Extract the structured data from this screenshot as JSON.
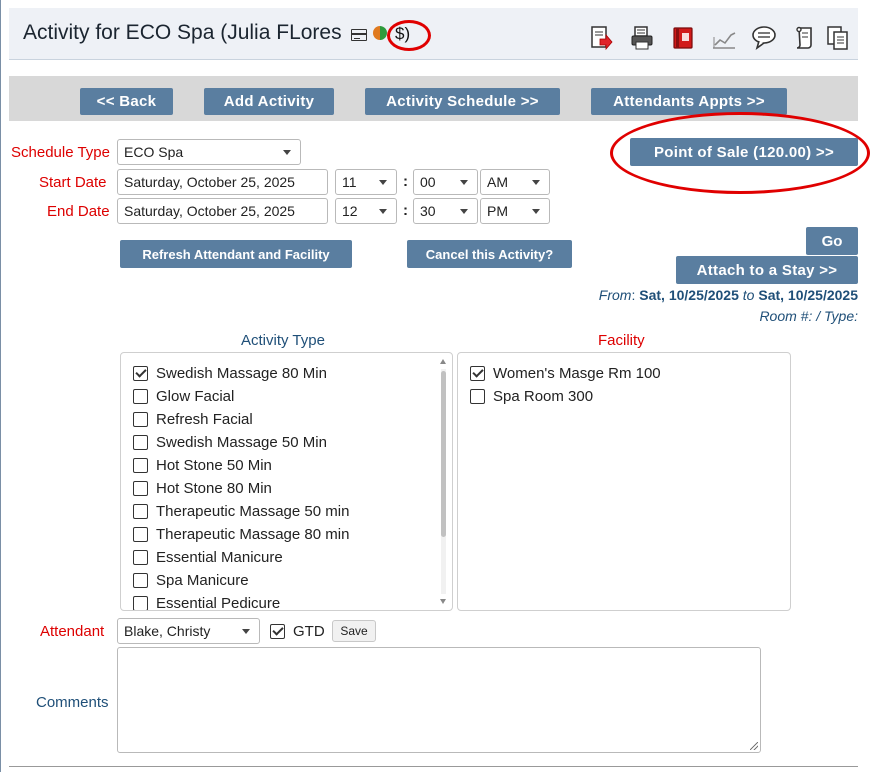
{
  "header": {
    "title": "Activity for ECO Spa (Julia FLores",
    "dollar_text": "$)",
    "toolbar_icons": [
      "export-icon",
      "print-icon",
      "book-icon",
      "chart-icon",
      "comment-icon",
      "scroll-icon",
      "documents-icon"
    ]
  },
  "nav": {
    "back": "<< Back",
    "add_activity": "Add Activity",
    "activity_schedule": "Activity Schedule >>",
    "attendants_appts": "Attendants Appts >>"
  },
  "form": {
    "schedule_type_label": "Schedule Type",
    "schedule_type_value": "ECO Spa",
    "start_date_label": "Start Date",
    "start_date_value": "Saturday, October 25, 2025",
    "start_hour": "11",
    "start_minute": "00",
    "start_ampm": "AM",
    "end_date_label": "End Date",
    "end_date_value": "Saturday, October 25, 2025",
    "end_hour": "12",
    "end_minute": "30",
    "end_ampm": "PM",
    "colon": ":"
  },
  "buttons": {
    "point_of_sale": "Point of Sale (120.00) >>",
    "refresh": "Refresh Attendant and Facility",
    "cancel_activity": "Cancel this Activity?",
    "go": "Go",
    "attach_stay": "Attach to a Stay >>",
    "save": "Save"
  },
  "range": {
    "from_label": "From",
    "from_value": "Sat, 10/25/2025",
    "to_label": "to",
    "to_value": "Sat, 10/25/2025",
    "room_text": "Room #: / Type:"
  },
  "activity_type": {
    "heading": "Activity Type",
    "items": [
      {
        "label": "Swedish Massage 80 Min",
        "checked": true
      },
      {
        "label": "Glow Facial",
        "checked": false
      },
      {
        "label": "Refresh Facial",
        "checked": false
      },
      {
        "label": "Swedish Massage 50 Min",
        "checked": false
      },
      {
        "label": "Hot Stone 50 Min",
        "checked": false
      },
      {
        "label": "Hot Stone 80 Min",
        "checked": false
      },
      {
        "label": "Therapeutic Massage 50 min",
        "checked": false
      },
      {
        "label": "Therapeutic Massage 80 min",
        "checked": false
      },
      {
        "label": "Essential Manicure",
        "checked": false
      },
      {
        "label": "Spa Manicure",
        "checked": false
      },
      {
        "label": "Essential Pedicure",
        "checked": false
      }
    ]
  },
  "facility": {
    "heading": "Facility",
    "items": [
      {
        "label": "Women's Masge Rm 100",
        "checked": true
      },
      {
        "label": "Spa Room 300",
        "checked": false
      }
    ]
  },
  "attendant": {
    "label": "Attendant",
    "value": "Blake, Christy",
    "gtd_label": "GTD",
    "gtd_checked": true
  },
  "comments": {
    "label": "Comments",
    "value": ""
  },
  "colors": {
    "button_blue": "#5a7ea0",
    "label_red": "#dd0000",
    "label_blue": "#1f4f78",
    "annotation_red": "#e00000"
  }
}
